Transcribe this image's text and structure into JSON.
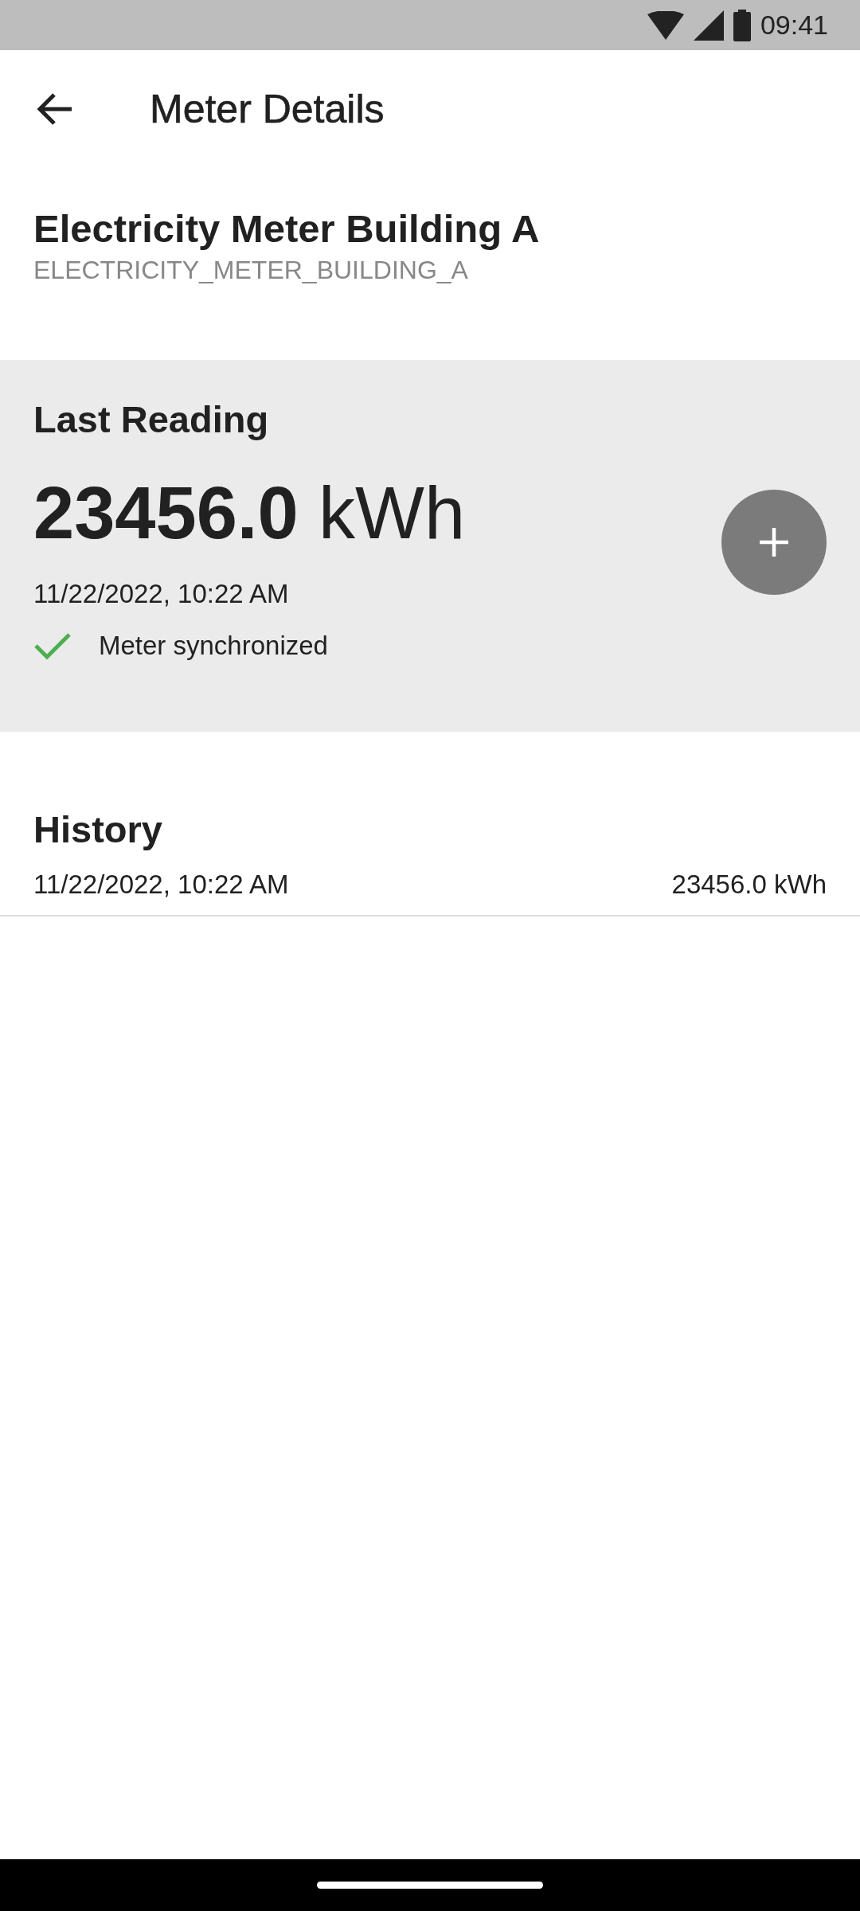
{
  "status_bar": {
    "time": "09:41"
  },
  "app_bar": {
    "title": "Meter Details"
  },
  "meter": {
    "name": "Electricity Meter Building A",
    "id": "ELECTRICITY_METER_BUILDING_A"
  },
  "last_reading": {
    "heading": "Last Reading",
    "value": "23456.0",
    "unit": "kWh",
    "timestamp": "11/22/2022, 10:22 AM",
    "sync": {
      "label": "Meter synchronized",
      "synced": true
    }
  },
  "history": {
    "heading": "History",
    "rows": [
      {
        "timestamp": "11/22/2022, 10:22 AM",
        "value": "23456.0 kWh"
      }
    ]
  }
}
